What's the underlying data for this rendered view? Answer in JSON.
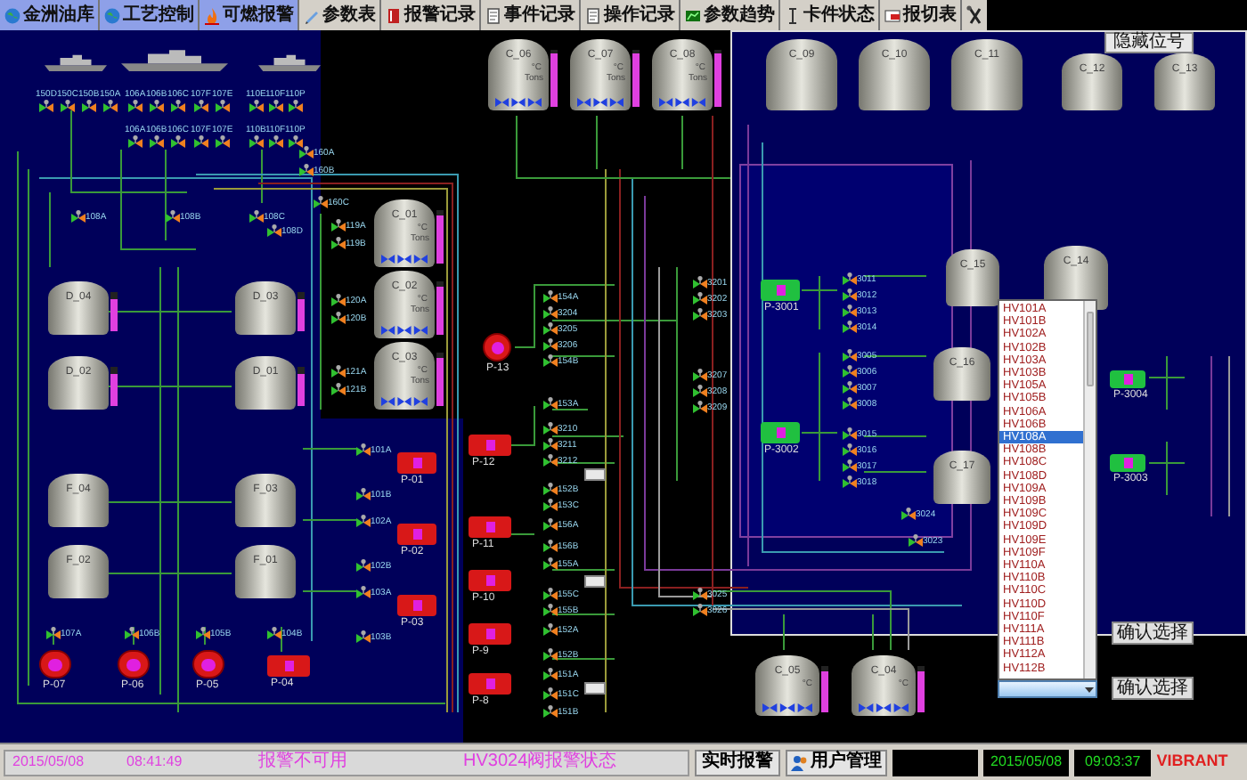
{
  "toolbar": [
    {
      "label": "金洲油库",
      "highlighted": true
    },
    {
      "label": "工艺控制",
      "highlighted": true
    },
    {
      "label": "可燃报警",
      "highlighted": true
    },
    {
      "label": "参数表",
      "highlighted": false
    },
    {
      "label": "报警记录",
      "highlighted": false
    },
    {
      "label": "事件记录",
      "highlighted": false
    },
    {
      "label": "操作记录",
      "highlighted": false
    },
    {
      "label": "参数趋势",
      "highlighted": false
    },
    {
      "label": "卡件状态",
      "highlighted": false
    },
    {
      "label": "报切表",
      "highlighted": false
    }
  ],
  "hide_tags_button": "隐藏位号",
  "tanks": [
    {
      "label": "C_06",
      "kind": "instrumented",
      "temp_unit": "°C",
      "weight_unit": "Tons",
      "level": 0.95
    },
    {
      "label": "C_07",
      "kind": "instrumented",
      "temp_unit": "°C",
      "weight_unit": "Tons",
      "level": 0.95
    },
    {
      "label": "C_08",
      "kind": "instrumented",
      "temp_unit": "°C",
      "weight_unit": "Tons",
      "level": 0.95
    },
    {
      "label": "C_09",
      "kind": "plain"
    },
    {
      "label": "C_10",
      "kind": "plain"
    },
    {
      "label": "C_11",
      "kind": "plain"
    },
    {
      "label": "C_12",
      "kind": "plain"
    },
    {
      "label": "C_13",
      "kind": "plain"
    },
    {
      "label": "C_01",
      "kind": "instrumented",
      "temp_unit": "°C",
      "weight_unit": "Tons",
      "level": 0.9
    },
    {
      "label": "C_02",
      "kind": "instrumented",
      "temp_unit": "°C",
      "weight_unit": "Tons",
      "level": 0.9
    },
    {
      "label": "C_03",
      "kind": "instrumented",
      "temp_unit": "°C",
      "weight_unit": "Tons",
      "level": 0.9
    },
    {
      "label": "D_04",
      "kind": "instrumented",
      "level": 0.8
    },
    {
      "label": "D_03",
      "kind": "instrumented",
      "level": 0.8
    },
    {
      "label": "D_02",
      "kind": "instrumented",
      "level": 0.8
    },
    {
      "label": "D_01",
      "kind": "instrumented",
      "level": 0.8
    },
    {
      "label": "F_04",
      "kind": "plain"
    },
    {
      "label": "F_03",
      "kind": "plain"
    },
    {
      "label": "F_02",
      "kind": "plain"
    },
    {
      "label": "F_01",
      "kind": "plain"
    },
    {
      "label": "C_15",
      "kind": "plain"
    },
    {
      "label": "C_14",
      "kind": "plain"
    },
    {
      "label": "C_16",
      "kind": "plain"
    },
    {
      "label": "C_17",
      "kind": "plain"
    },
    {
      "label": "C_05",
      "kind": "instrumented",
      "temp_unit": "°C",
      "level": 0.9
    },
    {
      "label": "C_04",
      "kind": "instrumented",
      "temp_unit": "°C",
      "level": 0.9
    }
  ],
  "pumps": [
    {
      "label": "P-07",
      "kind": "centrifugal",
      "running": false
    },
    {
      "label": "P-06",
      "kind": "centrifugal",
      "running": false
    },
    {
      "label": "P-05",
      "kind": "centrifugal",
      "running": false
    },
    {
      "label": "P-04",
      "kind": "motor",
      "running": false
    },
    {
      "label": "P-01",
      "kind": "motor",
      "running": false
    },
    {
      "label": "P-02",
      "kind": "motor",
      "running": false
    },
    {
      "label": "P-03",
      "kind": "motor",
      "running": false
    },
    {
      "label": "P-13",
      "kind": "centrifugal",
      "running": false
    },
    {
      "label": "P-12",
      "kind": "motor",
      "running": false
    },
    {
      "label": "P-11",
      "kind": "motor",
      "running": false
    },
    {
      "label": "P-10",
      "kind": "motor",
      "running": false
    },
    {
      "label": "P-9",
      "kind": "motor",
      "running": false
    },
    {
      "label": "P-8",
      "kind": "motor",
      "running": false
    },
    {
      "label": "P-3001",
      "kind": "motor",
      "running": true
    },
    {
      "label": "P-3002",
      "kind": "motor",
      "running": true
    },
    {
      "label": "P-3004",
      "kind": "motor",
      "running": true
    },
    {
      "label": "P-3003",
      "kind": "motor",
      "running": true
    }
  ],
  "valves": [
    {
      "label": "150D"
    },
    {
      "label": "150C"
    },
    {
      "label": "150B"
    },
    {
      "label": "150A"
    },
    {
      "label": "106A"
    },
    {
      "label": "106B"
    },
    {
      "label": "106C"
    },
    {
      "label": "107F"
    },
    {
      "label": "107E"
    },
    {
      "label": "110E"
    },
    {
      "label": "110F"
    },
    {
      "label": "110P"
    },
    {
      "label": "106A"
    },
    {
      "label": "106B"
    },
    {
      "label": "106C"
    },
    {
      "label": "107F"
    },
    {
      "label": "107E"
    },
    {
      "label": "110B"
    },
    {
      "label": "110F"
    },
    {
      "label": "110P"
    },
    {
      "label": "160A"
    },
    {
      "label": "160B"
    },
    {
      "label": "108A"
    },
    {
      "label": "108B"
    },
    {
      "label": "108C"
    },
    {
      "label": "108D"
    },
    {
      "label": "160C"
    },
    {
      "label": "119A"
    },
    {
      "label": "119B"
    },
    {
      "label": "120A"
    },
    {
      "label": "120B"
    },
    {
      "label": "121A"
    },
    {
      "label": "121B"
    },
    {
      "label": "154A"
    },
    {
      "label": "3204"
    },
    {
      "label": "3205"
    },
    {
      "label": "3206"
    },
    {
      "label": "154B"
    },
    {
      "label": "153A"
    },
    {
      "label": "3210"
    },
    {
      "label": "3211"
    },
    {
      "label": "3212"
    },
    {
      "label": "152B"
    },
    {
      "label": "153C"
    },
    {
      "label": "156A"
    },
    {
      "label": "156B"
    },
    {
      "label": "155A"
    },
    {
      "label": "155C"
    },
    {
      "label": "155B"
    },
    {
      "label": "152A"
    },
    {
      "label": "152B"
    },
    {
      "label": "151A"
    },
    {
      "label": "151C"
    },
    {
      "label": "151B"
    },
    {
      "label": "3201"
    },
    {
      "label": "3202"
    },
    {
      "label": "3203"
    },
    {
      "label": "3207"
    },
    {
      "label": "3208"
    },
    {
      "label": "3209"
    },
    {
      "label": "3025"
    },
    {
      "label": "3026"
    },
    {
      "label": "3011"
    },
    {
      "label": "3012"
    },
    {
      "label": "3013"
    },
    {
      "label": "3014"
    },
    {
      "label": "3005"
    },
    {
      "label": "3006"
    },
    {
      "label": "3007"
    },
    {
      "label": "3008"
    },
    {
      "label": "3015"
    },
    {
      "label": "3016"
    },
    {
      "label": "3017"
    },
    {
      "label": "3018"
    },
    {
      "label": "3024"
    },
    {
      "label": "3023"
    },
    {
      "label": "101A"
    },
    {
      "label": "101B"
    },
    {
      "label": "102A"
    },
    {
      "label": "102B"
    },
    {
      "label": "103A"
    },
    {
      "label": "103B"
    },
    {
      "label": "107A"
    },
    {
      "label": "106B"
    },
    {
      "label": "105B"
    },
    {
      "label": "104B"
    }
  ],
  "tag_list": {
    "items": [
      {
        "label": "HV101A",
        "selected": false
      },
      {
        "label": "HV101B",
        "selected": false
      },
      {
        "label": "HV102A",
        "selected": false
      },
      {
        "label": "HV102B",
        "selected": false
      },
      {
        "label": "HV103A",
        "selected": false
      },
      {
        "label": "HV103B",
        "selected": false
      },
      {
        "label": "HV105A",
        "selected": false
      },
      {
        "label": "HV105B",
        "selected": false
      },
      {
        "label": "HV106A",
        "selected": false
      },
      {
        "label": "HV106B",
        "selected": false
      },
      {
        "label": "HV108A",
        "selected": true
      },
      {
        "label": "HV108B",
        "selected": false
      },
      {
        "label": "HV108C",
        "selected": false
      },
      {
        "label": "HV108D",
        "selected": false
      },
      {
        "label": "HV109A",
        "selected": false
      },
      {
        "label": "HV109B",
        "selected": false
      },
      {
        "label": "HV109C",
        "selected": false
      },
      {
        "label": "HV109D",
        "selected": false
      },
      {
        "label": "HV109E",
        "selected": false
      },
      {
        "label": "HV109F",
        "selected": false
      },
      {
        "label": "HV110A",
        "selected": false
      },
      {
        "label": "HV110B",
        "selected": false
      },
      {
        "label": "HV110C",
        "selected": false
      },
      {
        "label": "HV110D",
        "selected": false
      },
      {
        "label": "HV110F",
        "selected": false
      },
      {
        "label": "HV111A",
        "selected": false
      },
      {
        "label": "HV111B",
        "selected": false
      },
      {
        "label": "HV112A",
        "selected": false
      },
      {
        "label": "HV112B",
        "selected": false
      }
    ]
  },
  "confirm_buttons": [
    "确认选择",
    "确认选择"
  ],
  "status_bar": {
    "date": "2015/05/08",
    "time": "08:41:49",
    "alarm_state": "报警不可用",
    "message": "HV3024阀报警状态",
    "realtime_alarm_button": "实时报警",
    "user_button": "用户管理",
    "clock_date": "2015/05/08",
    "clock_time": "09:03:37",
    "brand": "VIBRANT"
  }
}
